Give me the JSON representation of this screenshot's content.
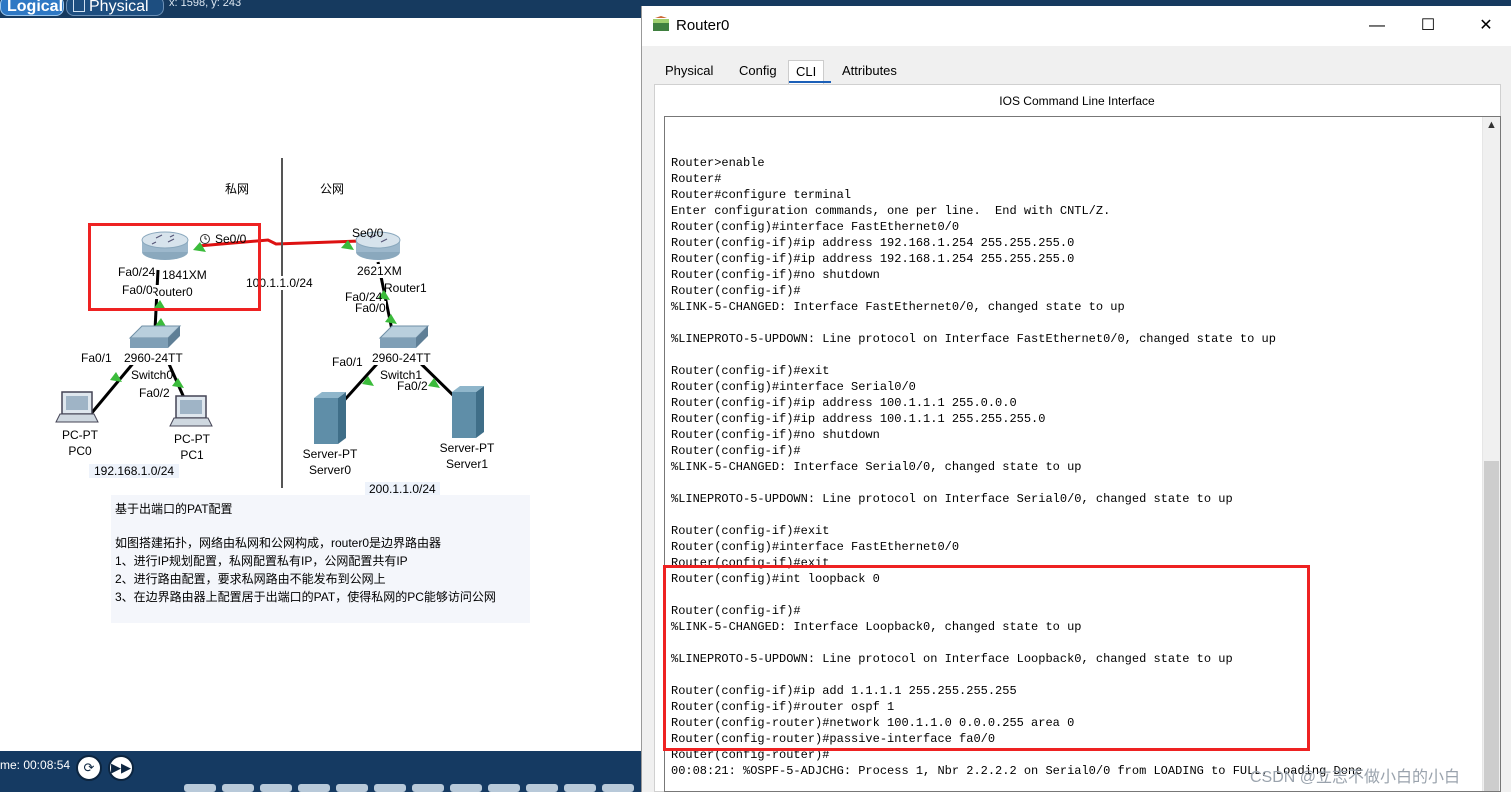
{
  "topbar": {
    "tab_logical": "Logical",
    "tab_physical": "Physical",
    "coords": "x: 1598, y: 243"
  },
  "canvas": {
    "zone_private": "私网",
    "zone_public": "公网",
    "router0": {
      "label_model": "1841XM",
      "label_name": "Router0",
      "port_se": "Se0/0",
      "port_fa24": "Fa0/24",
      "port_fa0": "Fa0/0"
    },
    "router1": {
      "label_model": "2621XM",
      "label_name": "Router1",
      "port_se": "Se0/0",
      "port_fa24": "Fa0/24",
      "port_fa0": "Fa0/0"
    },
    "link_label": "100.1.1.0/24",
    "switch0": {
      "model": "2960-24TT",
      "name": "Switch0",
      "port_fa01": "Fa0/1",
      "port_fa02": "Fa0/2"
    },
    "switch1": {
      "model": "2960-24TT",
      "name": "Switch1",
      "port_fa01": "Fa0/1",
      "port_fa02": "Fa0/2"
    },
    "pc0": {
      "type": "PC-PT",
      "name": "PC0"
    },
    "pc1": {
      "type": "PC-PT",
      "name": "PC1"
    },
    "server0": {
      "type": "Server-PT",
      "name": "Server0"
    },
    "server1": {
      "type": "Server-PT",
      "name": "Server1"
    },
    "net_private": "192.168.1.0/24",
    "net_public": "200.1.1.0/24",
    "note": {
      "title": "基于出端口的PAT配置",
      "lines": [
        "如图搭建拓扑，网络由私网和公网构成，router0是边界路由器",
        "1、进行IP规划配置，私网配置私有IP，公网配置共有IP",
        "2、进行路由配置，要求私网路由不能发布到公网上",
        "3、在边界路由器上配置居于出端口的PAT，使得私网的PC能够访问公网"
      ]
    }
  },
  "bottombar": {
    "time": "me: 00:08:54",
    "btn_power_icon": "power-cycle-icon",
    "btn_fast_icon": "fast-forward-icon"
  },
  "router_window": {
    "title": "Router0",
    "tabs": [
      "Physical",
      "Config",
      "CLI",
      "Attributes"
    ],
    "active_tab": "CLI",
    "panel_title": "IOS Command Line Interface",
    "terminal_lines": [
      "Router>enable",
      "Router#",
      "Router#configure terminal",
      "Enter configuration commands, one per line.  End with CNTL/Z.",
      "Router(config)#interface FastEthernet0/0",
      "Router(config-if)#ip address 192.168.1.254 255.255.255.0",
      "Router(config-if)#ip address 192.168.1.254 255.255.255.0",
      "Router(config-if)#no shutdown",
      "Router(config-if)#",
      "%LINK-5-CHANGED: Interface FastEthernet0/0, changed state to up",
      "",
      "%LINEPROTO-5-UPDOWN: Line protocol on Interface FastEthernet0/0, changed state to up",
      "",
      "Router(config-if)#exit",
      "Router(config)#interface Serial0/0",
      "Router(config-if)#ip address 100.1.1.1 255.0.0.0",
      "Router(config-if)#ip address 100.1.1.1 255.255.255.0",
      "Router(config-if)#no shutdown",
      "Router(config-if)#",
      "%LINK-5-CHANGED: Interface Serial0/0, changed state to up",
      "",
      "%LINEPROTO-5-UPDOWN: Line protocol on Interface Serial0/0, changed state to up",
      "",
      "Router(config-if)#exit",
      "Router(config)#interface FastEthernet0/0",
      "Router(config-if)#exit",
      "Router(config)#int loopback 0",
      "",
      "Router(config-if)#",
      "%LINK-5-CHANGED: Interface Loopback0, changed state to up",
      "",
      "%LINEPROTO-5-UPDOWN: Line protocol on Interface Loopback0, changed state to up",
      "",
      "Router(config-if)#ip add 1.1.1.1 255.255.255.255",
      "Router(config-if)#router ospf 1",
      "Router(config-router)#network 100.1.1.0 0.0.0.255 area 0",
      "Router(config-router)#passive-interface fa0/0",
      "Router(config-router)#",
      "00:08:21: %OSPF-5-ADJCHG: Process 1, Nbr 2.2.2.2 on Serial0/0 from LOADING to FULL, Loading Done"
    ],
    "watermark": "CSDN @立志不做小白的小白"
  },
  "colors": {
    "topbar": "#163a5f",
    "highlight_box": "#e22222",
    "cli_accent": "#1b5fb8"
  }
}
